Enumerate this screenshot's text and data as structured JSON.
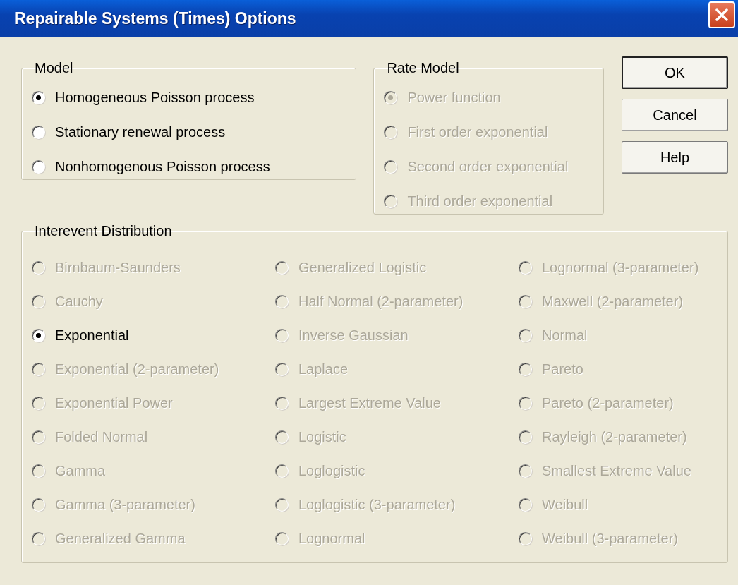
{
  "window": {
    "title": "Repairable Systems (Times) Options"
  },
  "model": {
    "title": "Model",
    "options": [
      {
        "label": "Homogeneous Poisson process",
        "selected": true,
        "disabled": false
      },
      {
        "label": "Stationary renewal process",
        "selected": false,
        "disabled": false
      },
      {
        "label": "Nonhomogenous Poisson process",
        "selected": false,
        "disabled": false
      }
    ]
  },
  "rate_model": {
    "title": "Rate Model",
    "options": [
      {
        "label": "Power function",
        "selected": true,
        "disabled": true
      },
      {
        "label": "First order exponential",
        "selected": false,
        "disabled": true
      },
      {
        "label": "Second order exponential",
        "selected": false,
        "disabled": true
      },
      {
        "label": "Third order exponential",
        "selected": false,
        "disabled": true
      }
    ]
  },
  "buttons": [
    {
      "label": "OK",
      "default": true
    },
    {
      "label": "Cancel",
      "default": false
    },
    {
      "label": "Help",
      "default": false
    }
  ],
  "interevent_distribution": {
    "title": "Interevent Distribution",
    "options": [
      {
        "label": "Birnbaum-Saunders",
        "selected": false,
        "disabled": true
      },
      {
        "label": "Cauchy",
        "selected": false,
        "disabled": true
      },
      {
        "label": "Exponential",
        "selected": true,
        "disabled": false
      },
      {
        "label": "Exponential (2-parameter)",
        "selected": false,
        "disabled": true
      },
      {
        "label": "Exponential Power",
        "selected": false,
        "disabled": true
      },
      {
        "label": "Folded Normal",
        "selected": false,
        "disabled": true
      },
      {
        "label": "Gamma",
        "selected": false,
        "disabled": true
      },
      {
        "label": "Gamma (3-parameter)",
        "selected": false,
        "disabled": true
      },
      {
        "label": "Generalized Gamma",
        "selected": false,
        "disabled": true
      },
      {
        "label": "Generalized Logistic",
        "selected": false,
        "disabled": true
      },
      {
        "label": "Half Normal (2-parameter)",
        "selected": false,
        "disabled": true
      },
      {
        "label": "Inverse Gaussian",
        "selected": false,
        "disabled": true
      },
      {
        "label": "Laplace",
        "selected": false,
        "disabled": true
      },
      {
        "label": "Largest Extreme Value",
        "selected": false,
        "disabled": true
      },
      {
        "label": "Logistic",
        "selected": false,
        "disabled": true
      },
      {
        "label": "Loglogistic",
        "selected": false,
        "disabled": true
      },
      {
        "label": "Loglogistic (3-parameter)",
        "selected": false,
        "disabled": true
      },
      {
        "label": "Lognormal",
        "selected": false,
        "disabled": true
      },
      {
        "label": "Lognormal (3-parameter)",
        "selected": false,
        "disabled": true
      },
      {
        "label": "Maxwell (2-parameter)",
        "selected": false,
        "disabled": true
      },
      {
        "label": "Normal",
        "selected": false,
        "disabled": true
      },
      {
        "label": "Pareto",
        "selected": false,
        "disabled": true
      },
      {
        "label": "Pareto (2-parameter)",
        "selected": false,
        "disabled": true
      },
      {
        "label": "Rayleigh (2-parameter)",
        "selected": false,
        "disabled": true
      },
      {
        "label": "Smallest Extreme Value",
        "selected": false,
        "disabled": true
      },
      {
        "label": "Weibull",
        "selected": false,
        "disabled": true
      },
      {
        "label": "Weibull (3-parameter)",
        "selected": false,
        "disabled": true
      }
    ]
  }
}
